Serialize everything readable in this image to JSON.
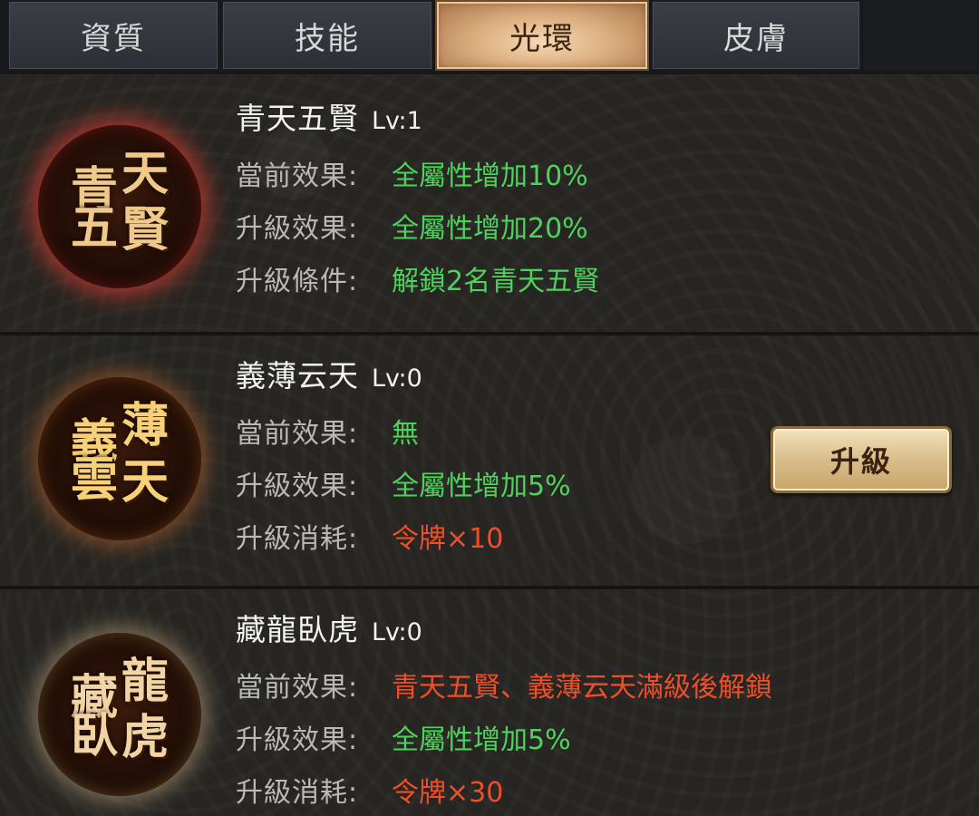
{
  "tabs": [
    {
      "label": "資質"
    },
    {
      "label": "技能"
    },
    {
      "label": "光環"
    },
    {
      "label": "皮膚"
    }
  ],
  "active_tab": "光環",
  "auras": [
    {
      "name": "青天五賢",
      "level": "Lv:1",
      "emblem_chars": [
        "青",
        "天",
        "五",
        "賢"
      ],
      "lines": [
        {
          "label": "當前效果:",
          "value": "全屬性增加10%",
          "color": "green"
        },
        {
          "label": "升級效果:",
          "value": "全屬性增加20%",
          "color": "green"
        },
        {
          "label": "升級條件:",
          "value": "解鎖2名青天五賢",
          "color": "green"
        }
      ]
    },
    {
      "name": "義薄云天",
      "level": "Lv:0",
      "emblem_chars": [
        "義",
        "薄",
        "雲",
        "天"
      ],
      "lines": [
        {
          "label": "當前效果:",
          "value": "無",
          "color": "green"
        },
        {
          "label": "升級效果:",
          "value": "全屬性增加5%",
          "color": "green"
        },
        {
          "label": "升級消耗:",
          "value": "令牌×10",
          "color": "red"
        }
      ],
      "upgrade_label": "升級"
    },
    {
      "name": "藏龍臥虎",
      "level": "Lv:0",
      "emblem_chars": [
        "藏",
        "龍",
        "臥",
        "虎"
      ],
      "lines": [
        {
          "label": "當前效果:",
          "value": "青天五賢、義薄云天滿級後解鎖",
          "color": "red"
        },
        {
          "label": "升級效果:",
          "value": "全屬性增加5%",
          "color": "green"
        },
        {
          "label": "升級消耗:",
          "value": "令牌×30",
          "color": "red"
        }
      ]
    }
  ],
  "colors": {
    "green": "#4fd25d",
    "red": "#ee4f2a",
    "tab_active": "#dcae80"
  }
}
